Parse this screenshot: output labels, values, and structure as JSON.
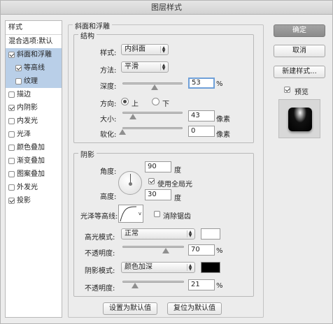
{
  "window": {
    "title": "图层样式"
  },
  "left_panel": {
    "header": "样式",
    "items": [
      {
        "label": "混合选项:默认",
        "checkbox": false,
        "sub": false,
        "selected": false
      },
      {
        "label": "斜面和浮雕",
        "checkbox": true,
        "checked": true,
        "sub": false,
        "selected": true
      },
      {
        "label": "等高线",
        "checkbox": true,
        "checked": true,
        "sub": true,
        "selected": true
      },
      {
        "label": "纹理",
        "checkbox": true,
        "checked": false,
        "sub": true,
        "selected": true
      },
      {
        "label": "描边",
        "checkbox": true,
        "checked": false,
        "sub": false,
        "selected": false
      },
      {
        "label": "内阴影",
        "checkbox": true,
        "checked": true,
        "sub": false,
        "selected": false
      },
      {
        "label": "内发光",
        "checkbox": true,
        "checked": false,
        "sub": false,
        "selected": false
      },
      {
        "label": "光泽",
        "checkbox": true,
        "checked": false,
        "sub": false,
        "selected": false
      },
      {
        "label": "颜色叠加",
        "checkbox": true,
        "checked": false,
        "sub": false,
        "selected": false
      },
      {
        "label": "渐变叠加",
        "checkbox": true,
        "checked": false,
        "sub": false,
        "selected": false
      },
      {
        "label": "图案叠加",
        "checkbox": true,
        "checked": false,
        "sub": false,
        "selected": false
      },
      {
        "label": "外发光",
        "checkbox": true,
        "checked": false,
        "sub": false,
        "selected": false
      },
      {
        "label": "投影",
        "checkbox": true,
        "checked": true,
        "sub": false,
        "selected": false
      }
    ]
  },
  "bevel": {
    "group_title": "斜面和浮雕",
    "structure_title": "结构",
    "style_label": "样式:",
    "style_value": "内斜面",
    "technique_label": "方法:",
    "technique_value": "平滑",
    "depth_label": "深度:",
    "depth_value": "53",
    "depth_unit": "%",
    "depth_slider": 0.53,
    "direction_label": "方向:",
    "direction_up": "上",
    "direction_down": "下",
    "size_label": "大小:",
    "size_value": "43",
    "size_unit": "像素",
    "size_slider": 0.17,
    "soften_label": "软化:",
    "soften_value": "0",
    "soften_unit": "像素",
    "soften_slider": 0.0
  },
  "shading": {
    "group_title": "阴影",
    "angle_label": "角度:",
    "angle_value": "90",
    "angle_unit": "度",
    "global_light_label": "使用全局光",
    "global_light_checked": true,
    "altitude_label": "高度:",
    "altitude_value": "30",
    "altitude_unit": "度",
    "gloss_contour_label": "光泽等高线:",
    "antialias_label": "消除锯齿",
    "antialias_checked": false,
    "highlight_mode_label": "高光模式:",
    "highlight_mode_value": "正常",
    "highlight_color": "#ffffff",
    "highlight_opacity_label": "不透明度:",
    "highlight_opacity_value": "70",
    "highlight_opacity_unit": "%",
    "highlight_opacity_slider": 0.7,
    "shadow_mode_label": "阴影模式:",
    "shadow_mode_value": "颜色加深",
    "shadow_color": "#000000",
    "shadow_opacity_label": "不透明度:",
    "shadow_opacity_value": "21",
    "shadow_opacity_unit": "%",
    "shadow_opacity_slider": 0.21
  },
  "footer": {
    "make_default": "设置为默认值",
    "reset_default": "复位为默认值"
  },
  "right_panel": {
    "ok": "确定",
    "cancel": "取消",
    "new_style": "新建样式...",
    "preview_label": "预览",
    "preview_checked": true
  },
  "colors": {
    "selection": "#b9cfe8",
    "accent": "#6fa0d8"
  }
}
